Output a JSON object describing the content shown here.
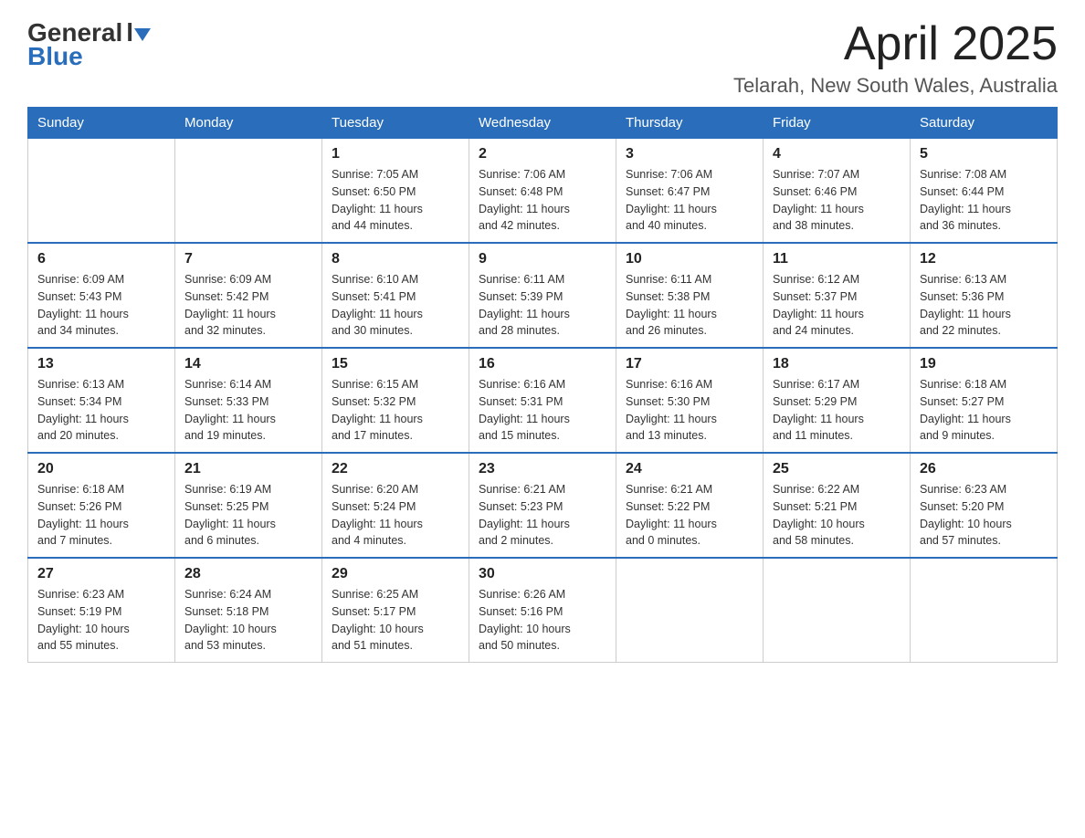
{
  "header": {
    "logo": {
      "general": "General",
      "blue": "Blue"
    },
    "title": "April 2025",
    "location": "Telarah, New South Wales, Australia"
  },
  "days_of_week": [
    "Sunday",
    "Monday",
    "Tuesday",
    "Wednesday",
    "Thursday",
    "Friday",
    "Saturday"
  ],
  "weeks": [
    [
      {
        "day": "",
        "info": ""
      },
      {
        "day": "",
        "info": ""
      },
      {
        "day": "1",
        "info": "Sunrise: 7:05 AM\nSunset: 6:50 PM\nDaylight: 11 hours\nand 44 minutes."
      },
      {
        "day": "2",
        "info": "Sunrise: 7:06 AM\nSunset: 6:48 PM\nDaylight: 11 hours\nand 42 minutes."
      },
      {
        "day": "3",
        "info": "Sunrise: 7:06 AM\nSunset: 6:47 PM\nDaylight: 11 hours\nand 40 minutes."
      },
      {
        "day": "4",
        "info": "Sunrise: 7:07 AM\nSunset: 6:46 PM\nDaylight: 11 hours\nand 38 minutes."
      },
      {
        "day": "5",
        "info": "Sunrise: 7:08 AM\nSunset: 6:44 PM\nDaylight: 11 hours\nand 36 minutes."
      }
    ],
    [
      {
        "day": "6",
        "info": "Sunrise: 6:09 AM\nSunset: 5:43 PM\nDaylight: 11 hours\nand 34 minutes."
      },
      {
        "day": "7",
        "info": "Sunrise: 6:09 AM\nSunset: 5:42 PM\nDaylight: 11 hours\nand 32 minutes."
      },
      {
        "day": "8",
        "info": "Sunrise: 6:10 AM\nSunset: 5:41 PM\nDaylight: 11 hours\nand 30 minutes."
      },
      {
        "day": "9",
        "info": "Sunrise: 6:11 AM\nSunset: 5:39 PM\nDaylight: 11 hours\nand 28 minutes."
      },
      {
        "day": "10",
        "info": "Sunrise: 6:11 AM\nSunset: 5:38 PM\nDaylight: 11 hours\nand 26 minutes."
      },
      {
        "day": "11",
        "info": "Sunrise: 6:12 AM\nSunset: 5:37 PM\nDaylight: 11 hours\nand 24 minutes."
      },
      {
        "day": "12",
        "info": "Sunrise: 6:13 AM\nSunset: 5:36 PM\nDaylight: 11 hours\nand 22 minutes."
      }
    ],
    [
      {
        "day": "13",
        "info": "Sunrise: 6:13 AM\nSunset: 5:34 PM\nDaylight: 11 hours\nand 20 minutes."
      },
      {
        "day": "14",
        "info": "Sunrise: 6:14 AM\nSunset: 5:33 PM\nDaylight: 11 hours\nand 19 minutes."
      },
      {
        "day": "15",
        "info": "Sunrise: 6:15 AM\nSunset: 5:32 PM\nDaylight: 11 hours\nand 17 minutes."
      },
      {
        "day": "16",
        "info": "Sunrise: 6:16 AM\nSunset: 5:31 PM\nDaylight: 11 hours\nand 15 minutes."
      },
      {
        "day": "17",
        "info": "Sunrise: 6:16 AM\nSunset: 5:30 PM\nDaylight: 11 hours\nand 13 minutes."
      },
      {
        "day": "18",
        "info": "Sunrise: 6:17 AM\nSunset: 5:29 PM\nDaylight: 11 hours\nand 11 minutes."
      },
      {
        "day": "19",
        "info": "Sunrise: 6:18 AM\nSunset: 5:27 PM\nDaylight: 11 hours\nand 9 minutes."
      }
    ],
    [
      {
        "day": "20",
        "info": "Sunrise: 6:18 AM\nSunset: 5:26 PM\nDaylight: 11 hours\nand 7 minutes."
      },
      {
        "day": "21",
        "info": "Sunrise: 6:19 AM\nSunset: 5:25 PM\nDaylight: 11 hours\nand 6 minutes."
      },
      {
        "day": "22",
        "info": "Sunrise: 6:20 AM\nSunset: 5:24 PM\nDaylight: 11 hours\nand 4 minutes."
      },
      {
        "day": "23",
        "info": "Sunrise: 6:21 AM\nSunset: 5:23 PM\nDaylight: 11 hours\nand 2 minutes."
      },
      {
        "day": "24",
        "info": "Sunrise: 6:21 AM\nSunset: 5:22 PM\nDaylight: 11 hours\nand 0 minutes."
      },
      {
        "day": "25",
        "info": "Sunrise: 6:22 AM\nSunset: 5:21 PM\nDaylight: 10 hours\nand 58 minutes."
      },
      {
        "day": "26",
        "info": "Sunrise: 6:23 AM\nSunset: 5:20 PM\nDaylight: 10 hours\nand 57 minutes."
      }
    ],
    [
      {
        "day": "27",
        "info": "Sunrise: 6:23 AM\nSunset: 5:19 PM\nDaylight: 10 hours\nand 55 minutes."
      },
      {
        "day": "28",
        "info": "Sunrise: 6:24 AM\nSunset: 5:18 PM\nDaylight: 10 hours\nand 53 minutes."
      },
      {
        "day": "29",
        "info": "Sunrise: 6:25 AM\nSunset: 5:17 PM\nDaylight: 10 hours\nand 51 minutes."
      },
      {
        "day": "30",
        "info": "Sunrise: 6:26 AM\nSunset: 5:16 PM\nDaylight: 10 hours\nand 50 minutes."
      },
      {
        "day": "",
        "info": ""
      },
      {
        "day": "",
        "info": ""
      },
      {
        "day": "",
        "info": ""
      }
    ]
  ]
}
